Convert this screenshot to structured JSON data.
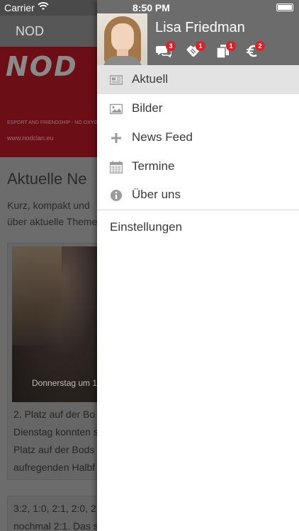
{
  "status_bar": {
    "carrier": "Carrier",
    "time": "8:50 PM"
  },
  "background": {
    "nav_title": "NOD",
    "banner_logo": "NOD",
    "banner_tagline": "ESPORT AND FRIENDSHIP - NO OXYG",
    "banner_url": "www.nodclan.eu",
    "heading": "Aktuelle Ne",
    "intro_line1": "Kurz, kompakt und",
    "intro_line2": "über aktuelle Theme",
    "card1": {
      "caption": "Donnerstag um 1",
      "lines": [
        "2. Platz auf der Bo",
        "Dienstag konnten s",
        "Platz auf der Bods",
        "aufregenden Halbf"
      ]
    },
    "card2": {
      "lines": [
        "3:2, 1:0, 2:1, 2:0, 2",
        "nochmal 2:1. Das s"
      ]
    }
  },
  "drawer": {
    "user_name": "Lisa Friedman",
    "header_icons": [
      {
        "icon": "chat-icon",
        "badge": "3"
      },
      {
        "icon": "handshake-icon",
        "badge": "1"
      },
      {
        "icon": "copy-icon",
        "badge": "1"
      },
      {
        "icon": "euro-icon",
        "badge": "2"
      }
    ],
    "menu": [
      {
        "label": "Aktuell",
        "icon": "newspaper-icon",
        "active": true
      },
      {
        "label": "Bilder",
        "icon": "image-icon",
        "active": false
      },
      {
        "label": "News Feed",
        "icon": "plus-icon",
        "active": false
      },
      {
        "label": "Termine",
        "icon": "calendar-icon",
        "active": false
      },
      {
        "label": "Über uns",
        "icon": "info-icon",
        "active": false
      }
    ],
    "settings_label": "Einstellungen"
  },
  "colors": {
    "badge": "#d8232a",
    "header_bg": "#6c6c6c",
    "active_item_bg": "#e3e3e3",
    "banner_bg": "#6b0e16"
  }
}
